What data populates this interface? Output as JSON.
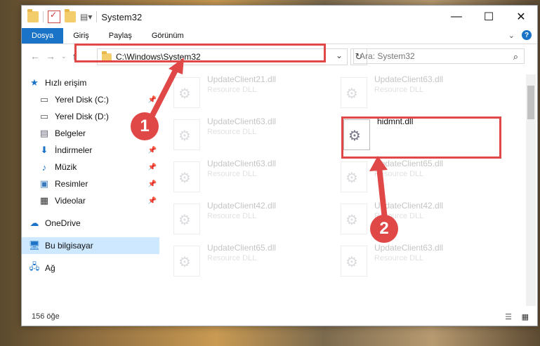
{
  "window": {
    "title": "System32"
  },
  "ribbon": {
    "tabs": [
      "Dosya",
      "Giriş",
      "Paylaş",
      "Görünüm"
    ]
  },
  "address": {
    "path": "C:\\Windows\\System32"
  },
  "search": {
    "placeholder": "Ara: System32"
  },
  "sidebar": {
    "items": [
      {
        "label": "Hızlı erişim",
        "icon": "star-icon"
      },
      {
        "label": "Yerel Disk (C:)",
        "icon": "drive-icon",
        "pinned": true
      },
      {
        "label": "Yerel Disk (D:)",
        "icon": "drive-icon"
      },
      {
        "label": "Belgeler",
        "icon": "document-icon"
      },
      {
        "label": "İndirmeler",
        "icon": "download-icon",
        "pinned": true
      },
      {
        "label": "Müzik",
        "icon": "music-icon",
        "pinned": true
      },
      {
        "label": "Resimler",
        "icon": "picture-icon",
        "pinned": true
      },
      {
        "label": "Videolar",
        "icon": "video-icon",
        "pinned": true
      },
      {
        "label": "OneDrive",
        "icon": "cloud-icon"
      },
      {
        "label": "Bu bilgisayar",
        "icon": "computer-icon",
        "selected": true
      },
      {
        "label": "Ağ",
        "icon": "network-icon"
      }
    ]
  },
  "files": [
    {
      "name": "UpdateClient21.dll",
      "type": "Resource DLL"
    },
    {
      "name": "UpdateClient63.dll",
      "type": "Resource DLL"
    },
    {
      "name": "UpdateClient63.dll",
      "type": "Resource DLL"
    },
    {
      "name": "hidmnt.dll",
      "type": ""
    },
    {
      "name": "UpdateClient63.dll",
      "type": "Resource DLL"
    },
    {
      "name": "UpdateClient65.dll",
      "type": "Resource DLL"
    },
    {
      "name": "UpdateClient42.dll",
      "type": "Resource DLL"
    },
    {
      "name": "UpdateClient42.dll",
      "type": "Resource DLL"
    },
    {
      "name": "UpdateClient65.dll",
      "type": "Resource DLL"
    },
    {
      "name": "UpdateClient63.dll",
      "type": "Resource DLL"
    }
  ],
  "status": {
    "count": "156 öğe"
  },
  "annotations": {
    "badge1": "1",
    "badge2": "2"
  }
}
